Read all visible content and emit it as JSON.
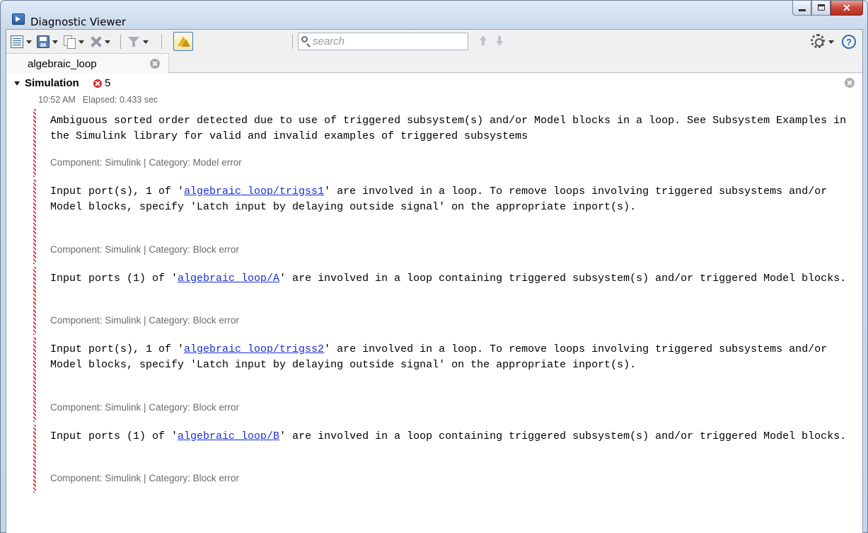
{
  "window": {
    "title": "Diagnostic Viewer"
  },
  "toolbar": {
    "search_placeholder": "search"
  },
  "tabs": [
    {
      "label": "algebraic_loop"
    }
  ],
  "section": {
    "title": "Simulation",
    "error_count": "5",
    "time": "10:52 AM",
    "elapsed": "Elapsed: 0.433 sec"
  },
  "messages": [
    {
      "pre": "Ambiguous sorted order detected due to use of triggered subsystem(s) and/or Model blocks in a loop. See Subsystem Examples in the Simulink library for valid and invalid examples of triggered subsystems",
      "link": "",
      "post": "",
      "meta": "Component: Simulink | Category: Model error"
    },
    {
      "pre": "Input port(s), 1 of '",
      "link": "algebraic_loop/trigss1",
      "post": "' are involved in a loop. To remove loops involving triggered subsystems and/or Model blocks, specify 'Latch input by delaying outside signal' on the appropriate inport(s).",
      "meta": "Component: Simulink | Category: Block error"
    },
    {
      "pre": "Input ports (1) of '",
      "link": "algebraic_loop/A",
      "post": "' are involved in a loop containing triggered subsystem(s) and/or triggered Model blocks.",
      "meta": "Component: Simulink | Category: Block error"
    },
    {
      "pre": "Input port(s), 1 of '",
      "link": "algebraic_loop/trigss2",
      "post": "' are involved in a loop. To remove loops involving triggered subsystems and/or Model blocks, specify 'Latch input by delaying outside signal' on the appropriate inport(s).",
      "meta": "Component: Simulink | Category: Block error"
    },
    {
      "pre": "Input ports (1) of '",
      "link": "algebraic_loop/B",
      "post": "' are involved in a loop containing triggered subsystem(s) and/or triggered Model blocks.",
      "meta": "Component: Simulink | Category: Block error"
    }
  ],
  "colors": {
    "error_red": "#d62b2b",
    "link_blue": "#1a2fd6"
  }
}
